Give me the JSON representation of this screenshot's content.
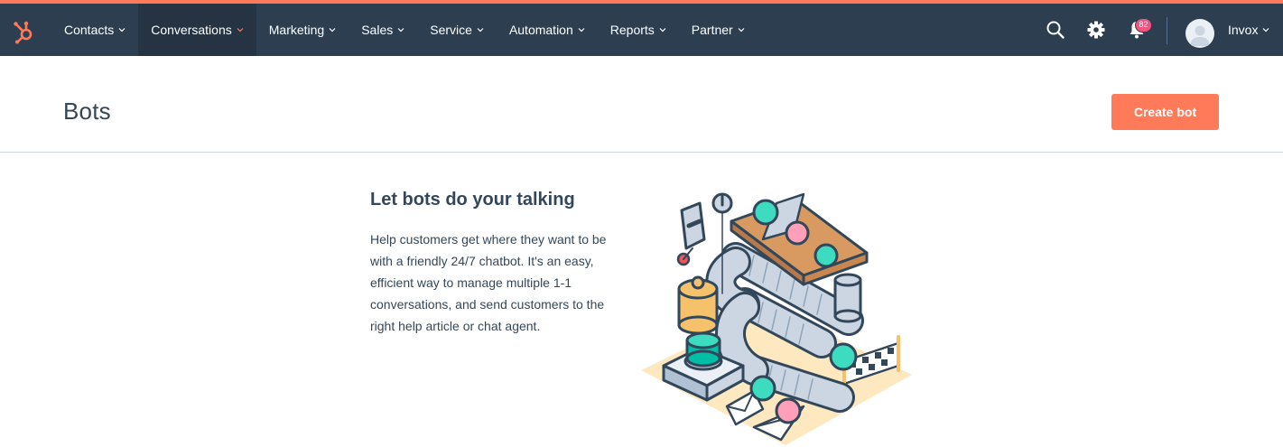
{
  "nav": {
    "items": [
      {
        "label": "Contacts",
        "active": false
      },
      {
        "label": "Conversations",
        "active": true
      },
      {
        "label": "Marketing",
        "active": false
      },
      {
        "label": "Sales",
        "active": false
      },
      {
        "label": "Service",
        "active": false
      },
      {
        "label": "Automation",
        "active": false
      },
      {
        "label": "Reports",
        "active": false
      },
      {
        "label": "Partner",
        "active": false
      }
    ],
    "notification_count": "82",
    "account_name": "Invox",
    "icons": [
      "sprocket-logo-icon",
      "search-icon",
      "settings-gear-icon",
      "notification-bell-icon",
      "avatar"
    ]
  },
  "header": {
    "title": "Bots",
    "create_button": "Create bot"
  },
  "empty_state": {
    "heading": "Let bots do your talking",
    "body": "Help customers get where they want to be with a friendly 24/7 chatbot. It's an easy, efficient way to manage multiple 1-1 conversations, and send customers to the right help article or chat agent."
  },
  "colors": {
    "nav_bg": "#2d3e50",
    "nav_active_bg": "#253342",
    "accent": "#ff7a59",
    "badge": "#f2547d",
    "text": "#33475b"
  }
}
